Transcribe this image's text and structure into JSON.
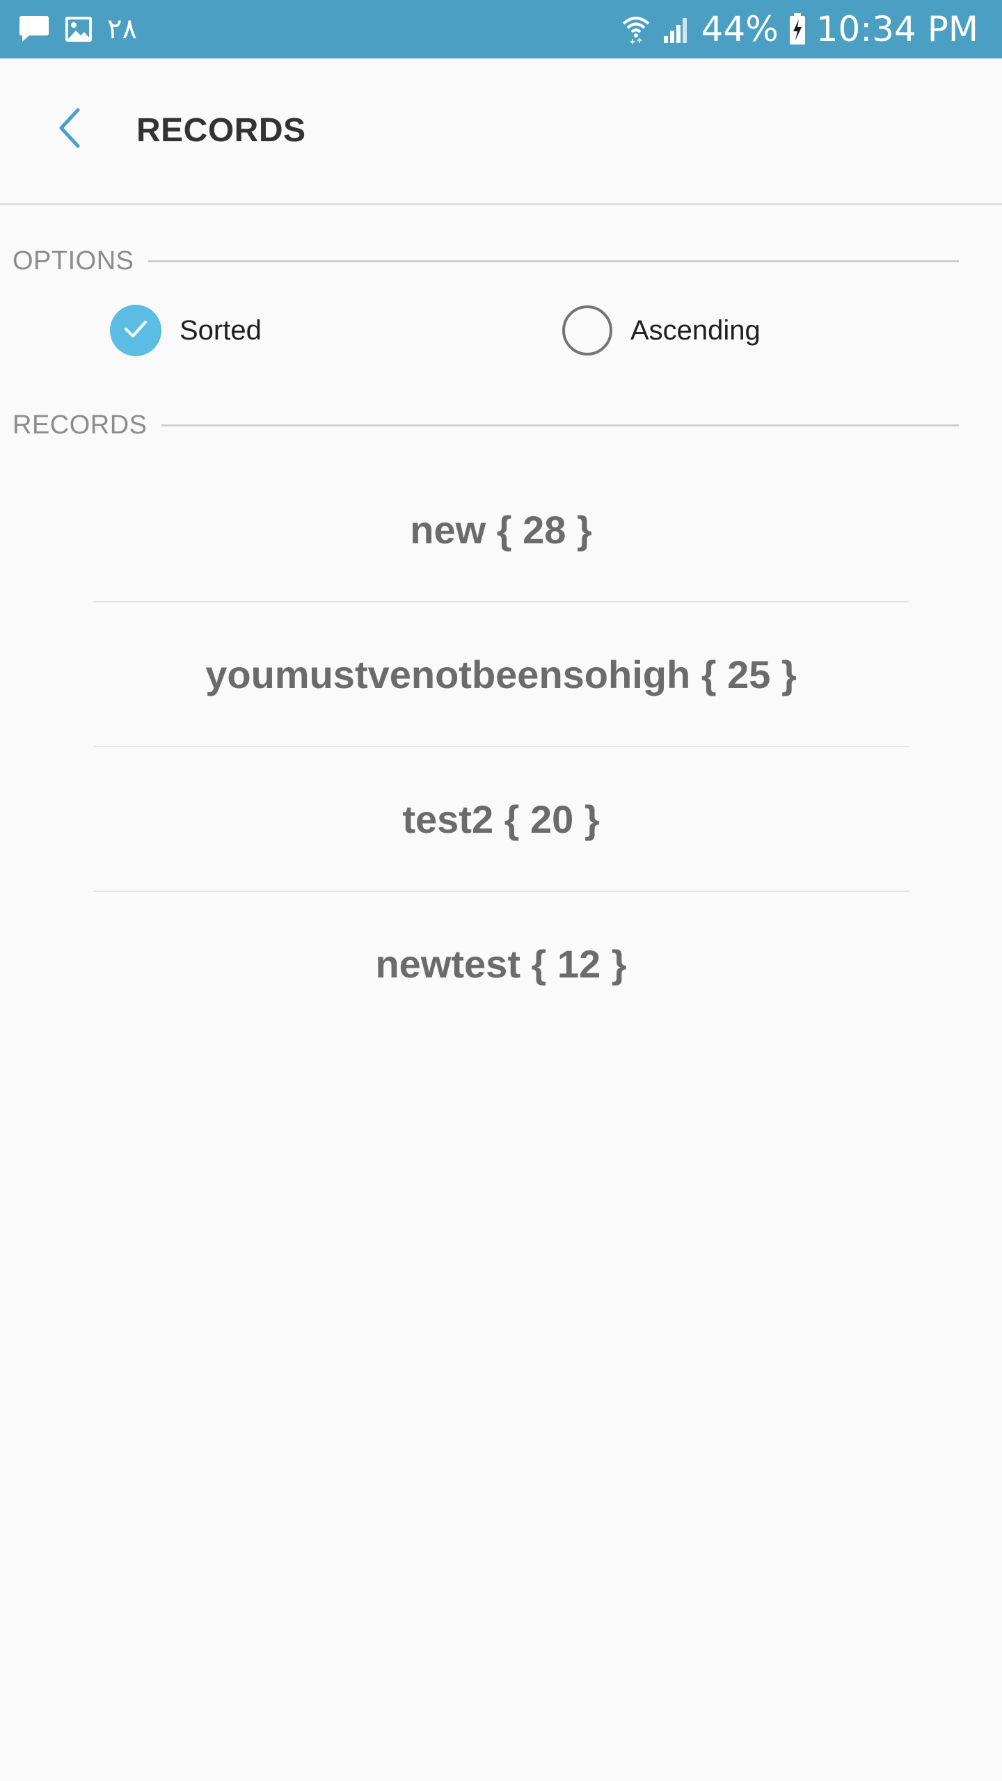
{
  "status_bar": {
    "left_text": "٢٨",
    "battery_percent": "44%",
    "time": "10:34 PM",
    "icons_left": [
      "message-icon",
      "image-icon"
    ],
    "icons_right": [
      "wifi-icon",
      "signal-icon",
      "battery-charging-icon"
    ]
  },
  "toolbar": {
    "title": "RECORDS"
  },
  "options_section": {
    "label": "OPTIONS",
    "sorted_label": "Sorted",
    "sorted_checked": true,
    "ascending_label": "Ascending",
    "ascending_checked": false
  },
  "records_section": {
    "label": "RECORDS"
  },
  "records": [
    {
      "text": "new { 28 }"
    },
    {
      "text": "youmustvenotbeensohigh { 25 }"
    },
    {
      "text": "test2 { 20 }"
    },
    {
      "text": "newtest { 12 }"
    }
  ],
  "colors": {
    "status_bar": "#4a9fc2",
    "accent": "#5bbde4",
    "background": "#fafafa"
  }
}
